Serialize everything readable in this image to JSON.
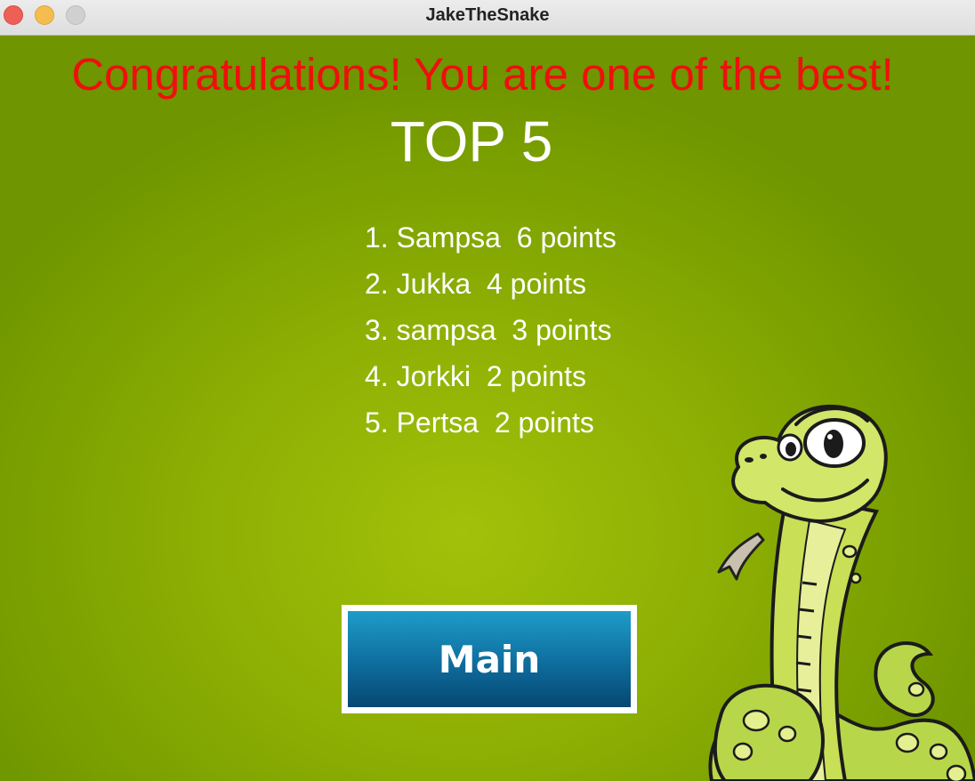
{
  "window": {
    "title": "JakeTheSnake",
    "controls": [
      "close",
      "minimize",
      "zoom"
    ]
  },
  "screen": {
    "congrats_message": "Congratulations! You are one of the best!",
    "heading": "TOP 5",
    "scores": [
      {
        "text": "1. Sampsa  6 points"
      },
      {
        "text": "2. Jukka  4 points"
      },
      {
        "text": "3. sampsa  3 points"
      },
      {
        "text": "4. Jorkki  2 points"
      },
      {
        "text": "5. Pertsa  2 points"
      }
    ],
    "main_button_label": "Main"
  },
  "colors": {
    "background": "#8fb004",
    "congrats_text": "#f00e0e",
    "button_top": "#1e9cc9",
    "button_bottom": "#064772",
    "button_border": "#ffffff"
  },
  "illustration": "cartoon-snake"
}
